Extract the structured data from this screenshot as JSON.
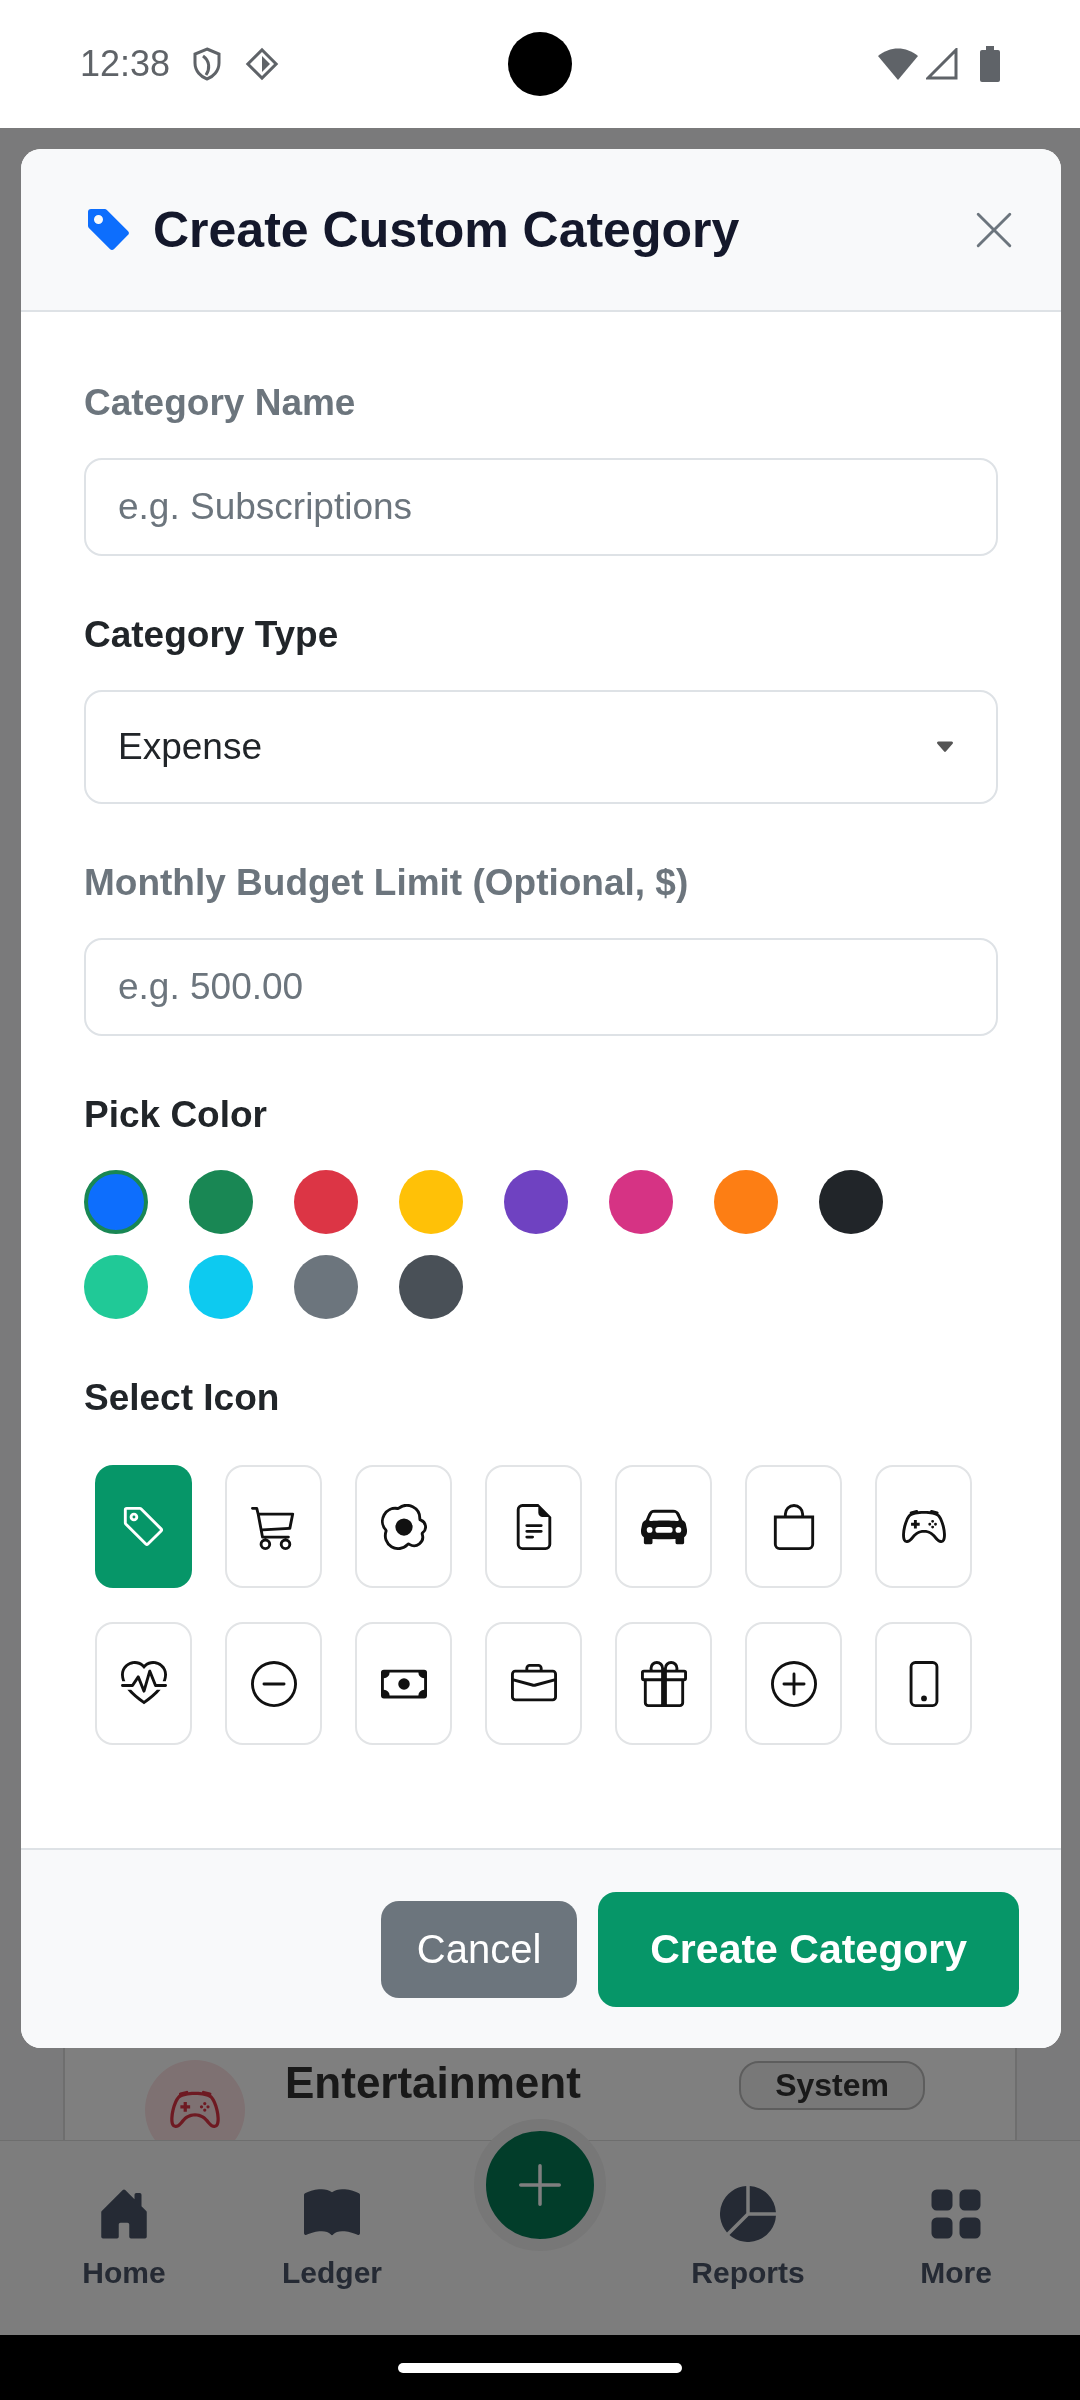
{
  "status_bar": {
    "time": "12:38"
  },
  "dialog": {
    "title": "Create Custom Category",
    "fields": [
      {
        "kind": "text",
        "label": "Category Name",
        "placeholder": "e.g. Subscriptions"
      },
      {
        "kind": "select",
        "label": "Category Type",
        "value": "Expense"
      },
      {
        "kind": "text",
        "label": "Monthly Budget Limit (Optional, $)",
        "placeholder": "e.g. 500.00"
      }
    ],
    "color_section": {
      "label": "Pick Color",
      "colors": [
        {
          "color": "#0d6efd",
          "selected": true
        },
        {
          "color": "#198754",
          "selected": false
        },
        {
          "color": "#dc3545",
          "selected": false
        },
        {
          "color": "#ffc107",
          "selected": false
        },
        {
          "color": "#6f42c1",
          "selected": false
        },
        {
          "color": "#d63384",
          "selected": false
        },
        {
          "color": "#fd7e14",
          "selected": false
        },
        {
          "color": "#212529",
          "selected": false
        },
        {
          "color": "#20c997",
          "selected": false
        },
        {
          "color": "#0dcaf0",
          "selected": false
        },
        {
          "color": "#6c757d",
          "selected": false
        },
        {
          "color": "#495057",
          "selected": false
        }
      ]
    },
    "icon_section": {
      "label": "Select Icon",
      "icons": [
        {
          "selected": true
        },
        {
          "selected": false
        },
        {
          "selected": false
        },
        {
          "selected": false
        },
        {
          "selected": false
        },
        {
          "selected": false
        },
        {
          "selected": false
        },
        {
          "selected": false
        },
        {
          "selected": false
        },
        {
          "selected": false
        },
        {
          "selected": false
        },
        {
          "selected": false
        },
        {
          "selected": false
        },
        {
          "selected": false
        }
      ]
    },
    "buttons": [
      {
        "kind": "secondary",
        "label": "Cancel"
      },
      {
        "kind": "primary",
        "label": "Create Category"
      }
    ]
  },
  "background": {
    "category_row": {
      "name": "Entertainment",
      "badge": "System"
    },
    "nav": [
      {
        "label": "Home"
      },
      {
        "label": "Ledger"
      },
      {
        "label": "Reports"
      },
      {
        "label": "More"
      }
    ]
  }
}
